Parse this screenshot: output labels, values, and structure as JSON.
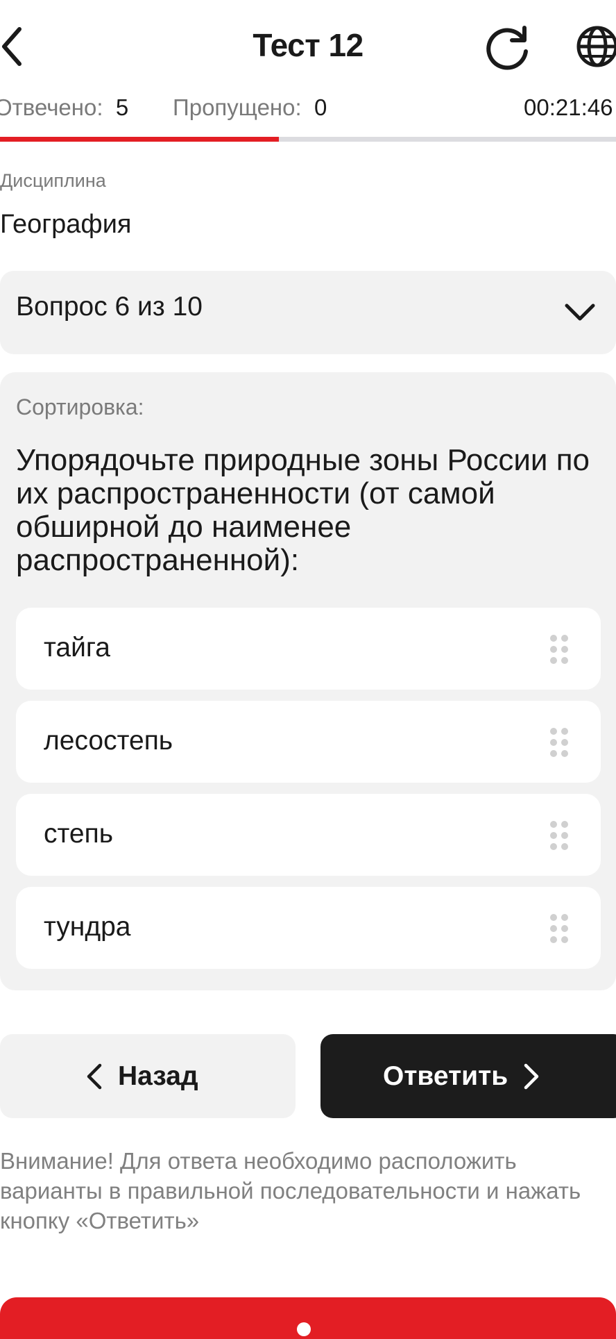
{
  "header": {
    "title": "Тест 12",
    "back_icon": "chevron-left-icon",
    "refresh_icon": "refresh-icon",
    "language_icon": "globe-icon"
  },
  "stats": {
    "answered_label": "Отвечено:",
    "answered_value": "5",
    "skipped_label": "Пропущено:",
    "skipped_value": "0",
    "timer": "00:21:46"
  },
  "progress": {
    "answered": 5,
    "total": 10,
    "fraction": 0.5,
    "color": "#e31e24"
  },
  "discipline": {
    "label": "Дисциплина",
    "value": "География"
  },
  "question_selector": {
    "label": "Вопрос 6 из 10",
    "icon": "chevron-down-icon"
  },
  "question": {
    "type_label": "Сортировка:",
    "text": "Упорядочьте природные зоны России по их распространенности (от самой обширной до наименее распространенной):",
    "options": [
      {
        "label": "тайга"
      },
      {
        "label": "лесостепь"
      },
      {
        "label": "степь"
      },
      {
        "label": "тундра"
      }
    ],
    "drag_icon": "drag-handle-icon"
  },
  "actions": {
    "back_label": "Назад",
    "answer_label": "Ответить"
  },
  "notice": "Внимание! Для ответа необходимо расположить варианты в правильной последовательности и нажать кнопку «Ответить»",
  "colors": {
    "accent": "#e31e24",
    "dark_button": "#1c1c1c",
    "card_bg": "#f2f2f2"
  }
}
